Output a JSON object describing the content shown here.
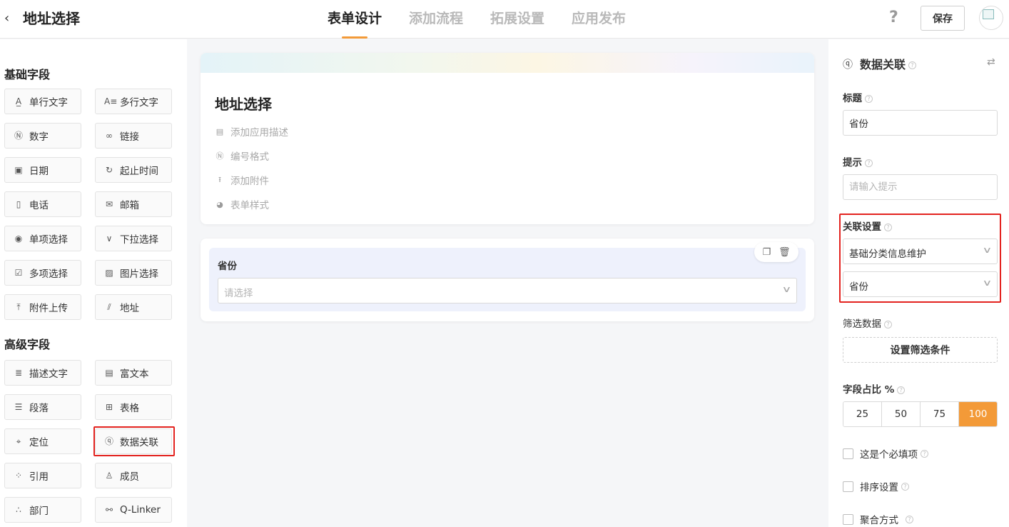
{
  "header": {
    "title": "地址选择",
    "tabs": [
      {
        "label": "表单设计",
        "active": true
      },
      {
        "label": "添加流程",
        "active": false
      },
      {
        "label": "拓展设置",
        "active": false
      },
      {
        "label": "应用发布",
        "active": false
      }
    ],
    "help_glyph": "?",
    "save_label": "保存",
    "accent_color": "#f39a38"
  },
  "left_panel": {
    "basic_title": "基础字段",
    "basic_fields": [
      {
        "label": "单行文字",
        "icon": "single-line-text-icon"
      },
      {
        "label": "多行文字",
        "icon": "multi-line-text-icon"
      },
      {
        "label": "数字",
        "icon": "number-icon"
      },
      {
        "label": "链接",
        "icon": "link-icon"
      },
      {
        "label": "日期",
        "icon": "calendar-icon"
      },
      {
        "label": "起止时间",
        "icon": "time-range-icon"
      },
      {
        "label": "电话",
        "icon": "phone-icon"
      },
      {
        "label": "邮箱",
        "icon": "mail-icon"
      },
      {
        "label": "单项选择",
        "icon": "radio-icon"
      },
      {
        "label": "下拉选择",
        "icon": "dropdown-icon"
      },
      {
        "label": "多项选择",
        "icon": "checkbox-icon"
      },
      {
        "label": "图片选择",
        "icon": "image-icon"
      },
      {
        "label": "附件上传",
        "icon": "upload-icon"
      },
      {
        "label": "地址",
        "icon": "address-icon"
      }
    ],
    "advanced_title": "高级字段",
    "advanced_fields": [
      {
        "label": "描述文字",
        "icon": "description-icon"
      },
      {
        "label": "富文本",
        "icon": "rich-text-icon"
      },
      {
        "label": "段落",
        "icon": "paragraph-icon"
      },
      {
        "label": "表格",
        "icon": "table-icon"
      },
      {
        "label": "定位",
        "icon": "location-icon"
      },
      {
        "label": "数据关联",
        "icon": "data-link-icon",
        "highlighted": true
      },
      {
        "label": "引用",
        "icon": "reference-icon"
      },
      {
        "label": "成员",
        "icon": "member-icon"
      },
      {
        "label": "部门",
        "icon": "department-icon"
      },
      {
        "label": "Q-Linker",
        "icon": "q-linker-icon"
      }
    ]
  },
  "form": {
    "title": "地址选择",
    "meta_items": [
      {
        "label": "添加应用描述",
        "icon": "comment-icon"
      },
      {
        "label": "编号格式",
        "icon": "number-format-icon"
      },
      {
        "label": "添加附件",
        "icon": "attachment-upload-icon"
      },
      {
        "label": "表单样式",
        "icon": "palette-icon"
      }
    ],
    "field": {
      "label": "省份",
      "placeholder": "请选择"
    }
  },
  "right_panel": {
    "title": "数据关联",
    "title_label": "标题",
    "title_value": "省份",
    "hint_label": "提示",
    "hint_placeholder": "请输入提示",
    "assoc_label": "关联设置",
    "assoc_form": "基础分类信息维护",
    "assoc_field": "省份",
    "filter_label": "筛选数据",
    "filter_button": "设置筛选条件",
    "ratio_label": "字段占比 %",
    "ratios": [
      "25",
      "50",
      "75",
      "100"
    ],
    "ratio_selected": "100",
    "checks": [
      {
        "label": "这是个必填项",
        "checked": false
      },
      {
        "label": "排序设置",
        "checked": false
      },
      {
        "label": "聚合方式",
        "checked": false
      }
    ],
    "highlight_color": "#e3231f"
  }
}
